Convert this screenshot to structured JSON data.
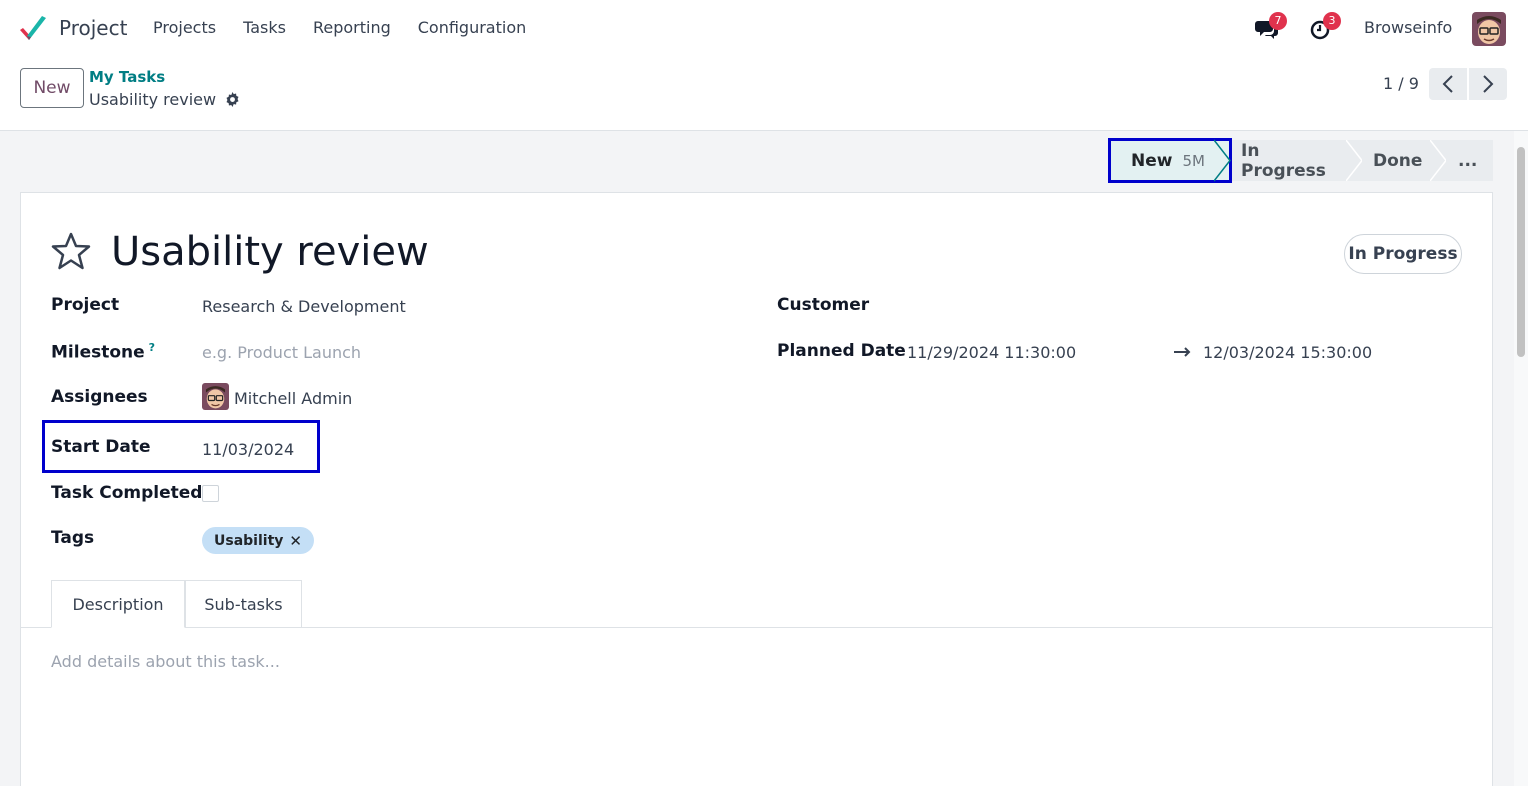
{
  "topbar": {
    "app_name": "Project",
    "menu": [
      "Projects",
      "Tasks",
      "Reporting",
      "Configuration"
    ],
    "messages_count": "7",
    "activities_count": "3",
    "user_name": "Browseinfo"
  },
  "control_panel": {
    "new_label": "New",
    "breadcrumb_parent": "My Tasks",
    "breadcrumb_current": "Usability review",
    "pager_value": "1 / 9"
  },
  "statusbar": {
    "stages": [
      {
        "label": "New",
        "duration": "5M",
        "active": true
      },
      {
        "label": "In Progress"
      },
      {
        "label": "Done"
      },
      {
        "label": "..."
      }
    ]
  },
  "task": {
    "title": "Usability review",
    "state": "In Progress",
    "fields": {
      "project_label": "Project",
      "project_value": "Research & Development",
      "milestone_label": "Milestone",
      "milestone_help": "?",
      "milestone_placeholder": "e.g. Product Launch",
      "assignees_label": "Assignees",
      "assignee_name": "Mitchell Admin",
      "start_date_label": "Start Date",
      "start_date_value": "11/03/2024",
      "task_completed_label": "Task Completed",
      "task_completed": false,
      "tags_label": "Tags",
      "tags": [
        "Usability"
      ],
      "customer_label": "Customer",
      "customer_value": "",
      "planned_date_label": "Planned Date",
      "planned_date_start": "11/29/2024 11:30:00",
      "planned_date_end": "12/03/2024 15:30:00"
    },
    "tabs": [
      "Description",
      "Sub-tasks"
    ],
    "description_placeholder": "Add details about this task..."
  },
  "colors": {
    "brand": "#714b67",
    "link": "#017e84",
    "badge": "#e0324d",
    "highlight": "#0000cc",
    "tag_bg": "#c4dff6"
  }
}
